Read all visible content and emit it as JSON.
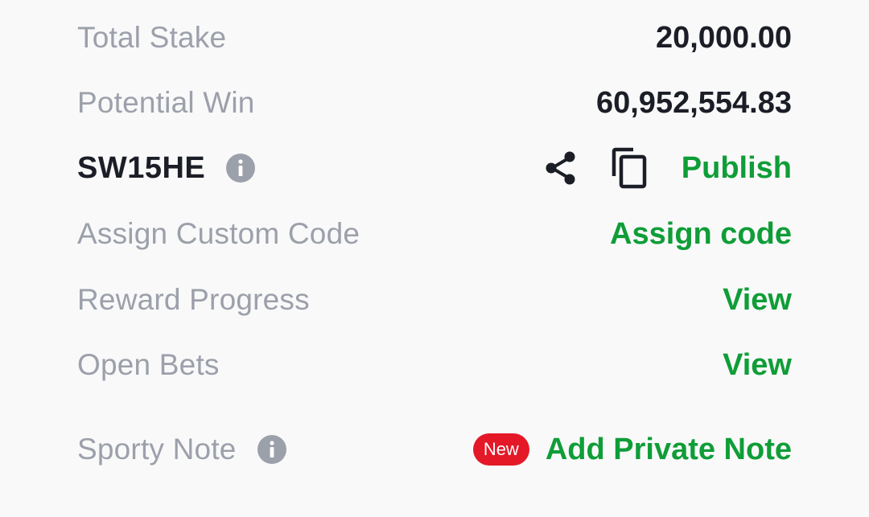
{
  "total_stake": {
    "label": "Total Stake",
    "value": "20,000.00"
  },
  "potential_win": {
    "label": "Potential Win",
    "value": "60,952,554.83"
  },
  "booking_code": {
    "code": "SW15HE",
    "info_icon": "info-icon",
    "share_icon": "share-icon",
    "copy_icon": "copy-icon",
    "publish_label": "Publish"
  },
  "custom_code": {
    "label": "Assign Custom Code",
    "action": "Assign code"
  },
  "reward_progress": {
    "label": "Reward Progress",
    "action": "View"
  },
  "open_bets": {
    "label": "Open Bets",
    "action": "View"
  },
  "sporty_note": {
    "label": "Sporty Note",
    "info_icon": "info-icon",
    "badge": "New",
    "action": "Add Private Note"
  },
  "colors": {
    "label_gray": "#9ca0aa",
    "value_dark": "#1b1e26",
    "action_green": "#0f9d37",
    "badge_red": "#e41827",
    "background": "#f9f9fa"
  }
}
